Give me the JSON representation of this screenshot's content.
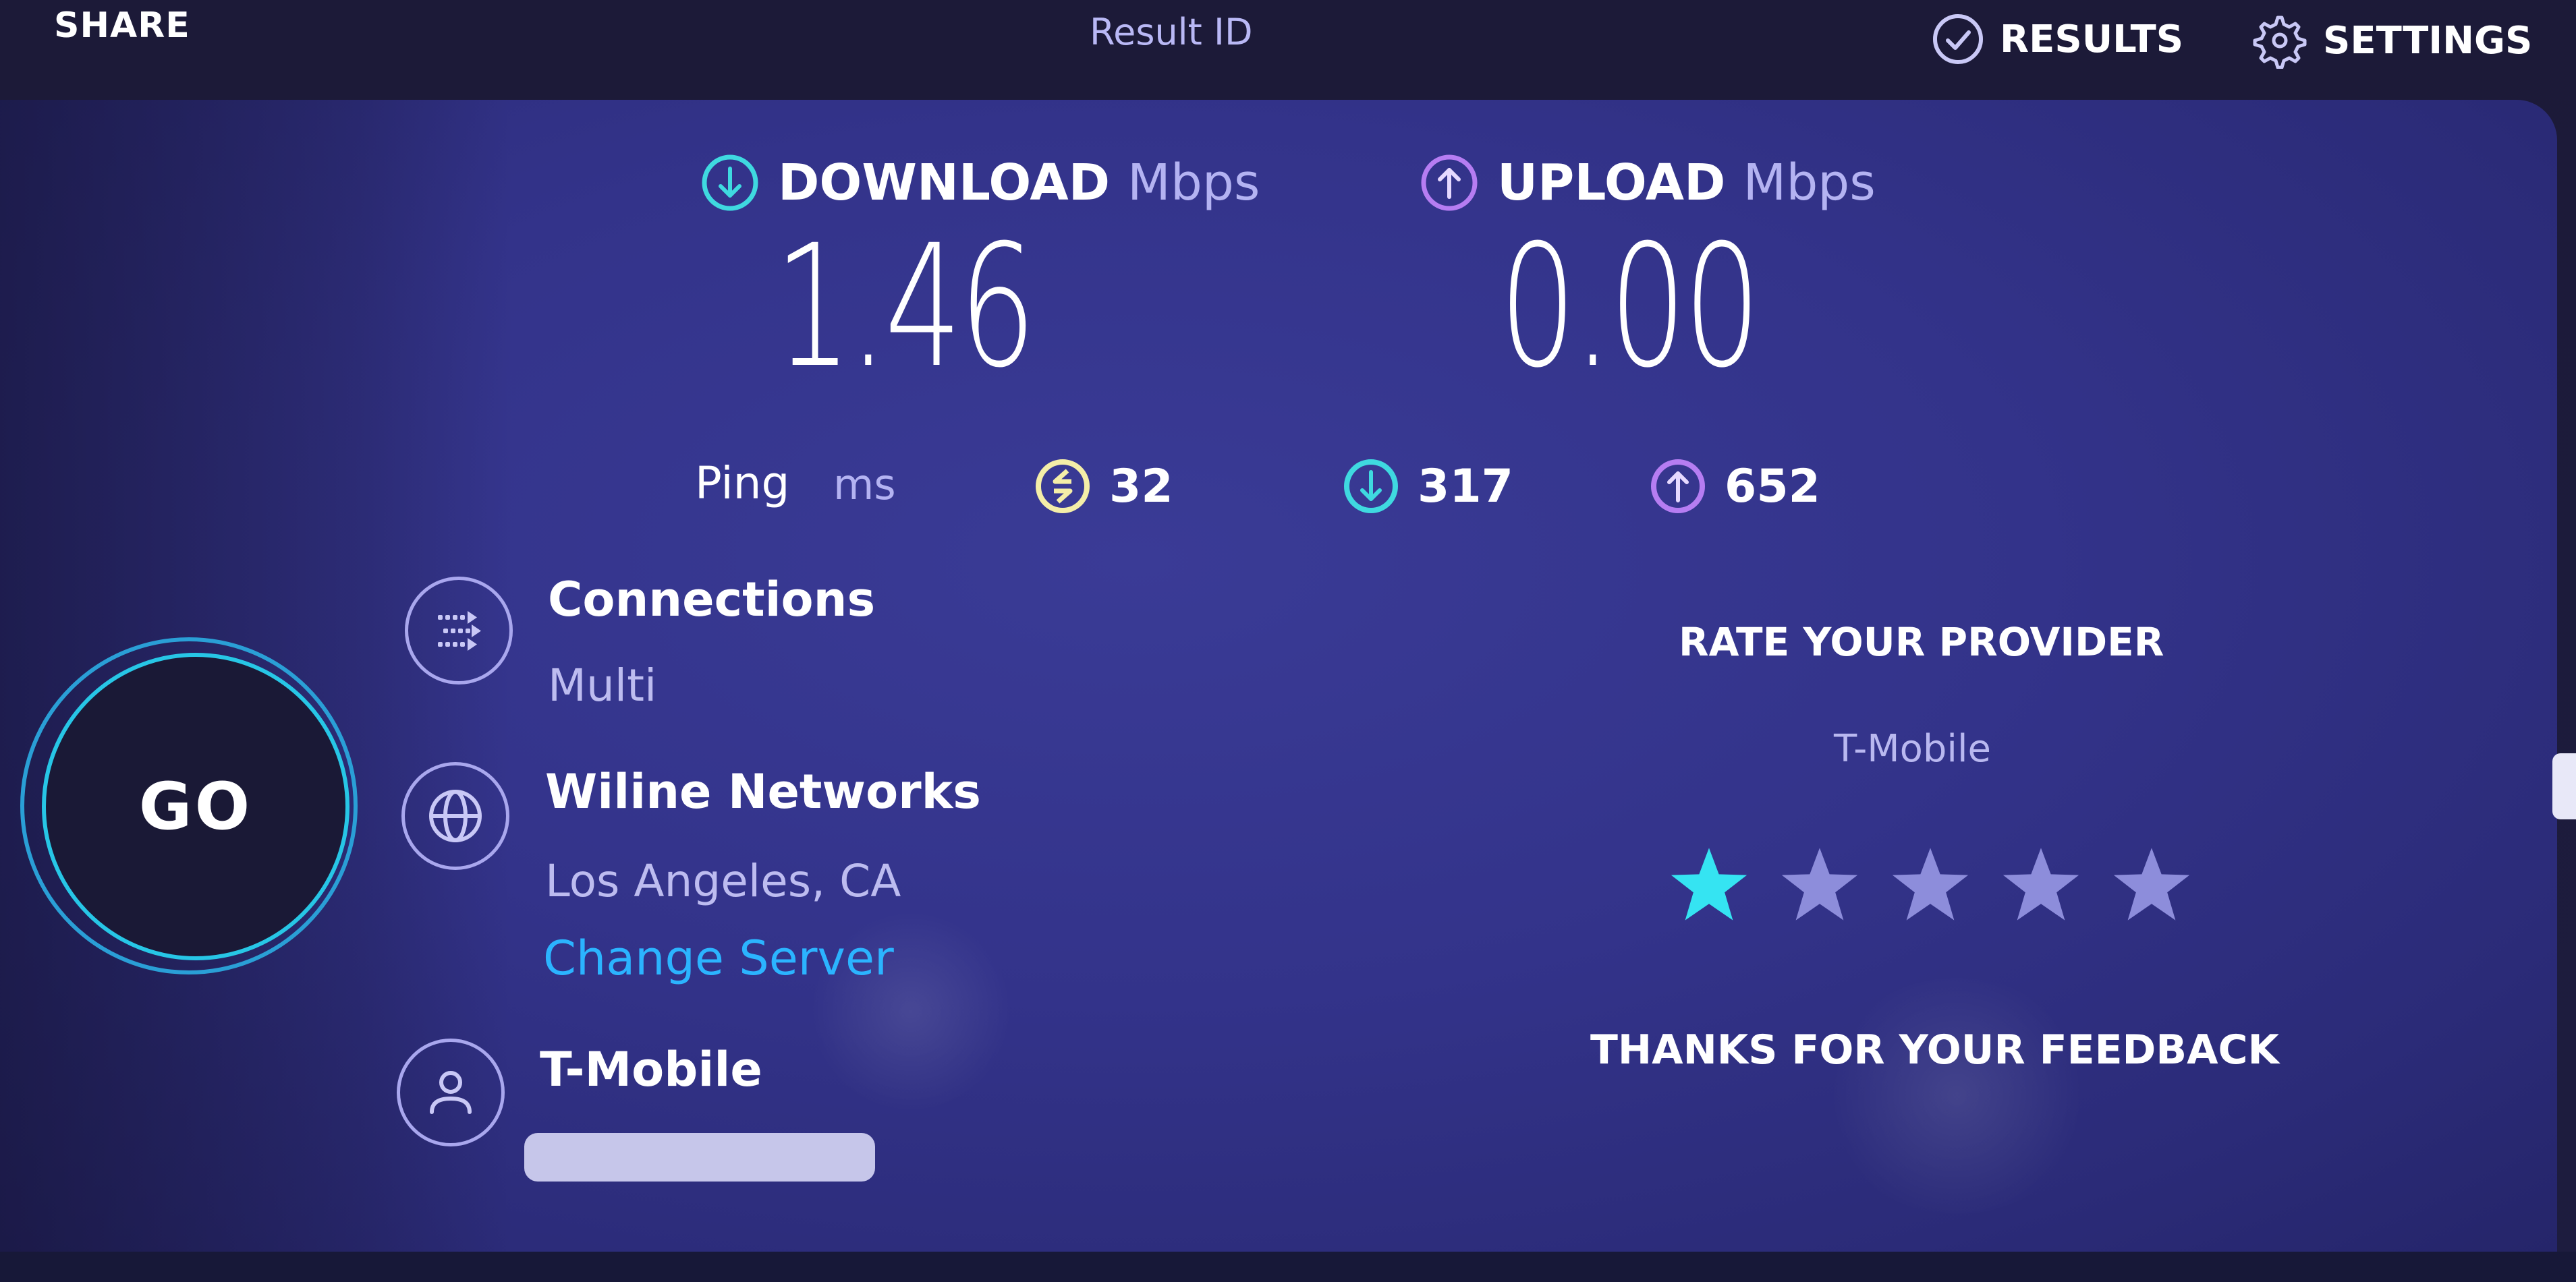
{
  "topbar": {
    "share_label": "SHARE",
    "result_id_label": "Result ID",
    "results_label": "RESULTS",
    "settings_label": "SETTINGS"
  },
  "download": {
    "label": "DOWNLOAD",
    "unit": "Mbps",
    "value": "1.46",
    "color": "#3fd9e0"
  },
  "upload": {
    "label": "UPLOAD",
    "unit": "Mbps",
    "value": "0.00",
    "color": "#b67df2"
  },
  "ping": {
    "label": "Ping",
    "unit": "ms",
    "idle": {
      "value": "32",
      "color": "#f4eea8"
    },
    "download": {
      "value": "317",
      "color": "#3fd9e0"
    },
    "upload": {
      "value": "652",
      "color": "#b67df2"
    }
  },
  "go_button": {
    "label": "GO"
  },
  "connections": {
    "title": "Connections",
    "value": "Multi"
  },
  "server": {
    "name": "Wiline Networks",
    "location": "Los Angeles, CA",
    "change_label": "Change Server"
  },
  "isp": {
    "name": "T-Mobile"
  },
  "rating": {
    "title": "RATE YOUR PROVIDER",
    "provider": "T-Mobile",
    "value": 1,
    "max": 5,
    "active_color": "#35e4f2",
    "inactive_color": "#8d8ddb",
    "feedback_text": "THANKS FOR YOUR FEEDBACK"
  }
}
